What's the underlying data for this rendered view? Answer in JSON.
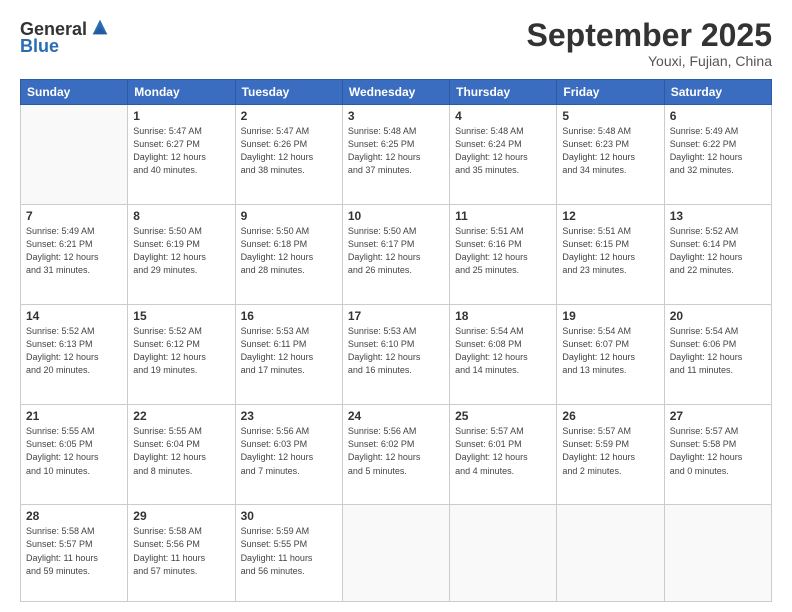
{
  "header": {
    "logo_general": "General",
    "logo_blue": "Blue",
    "month_title": "September 2025",
    "location": "Youxi, Fujian, China"
  },
  "weekdays": [
    "Sunday",
    "Monday",
    "Tuesday",
    "Wednesday",
    "Thursday",
    "Friday",
    "Saturday"
  ],
  "weeks": [
    [
      {
        "day": "",
        "info": ""
      },
      {
        "day": "1",
        "info": "Sunrise: 5:47 AM\nSunset: 6:27 PM\nDaylight: 12 hours\nand 40 minutes."
      },
      {
        "day": "2",
        "info": "Sunrise: 5:47 AM\nSunset: 6:26 PM\nDaylight: 12 hours\nand 38 minutes."
      },
      {
        "day": "3",
        "info": "Sunrise: 5:48 AM\nSunset: 6:25 PM\nDaylight: 12 hours\nand 37 minutes."
      },
      {
        "day": "4",
        "info": "Sunrise: 5:48 AM\nSunset: 6:24 PM\nDaylight: 12 hours\nand 35 minutes."
      },
      {
        "day": "5",
        "info": "Sunrise: 5:48 AM\nSunset: 6:23 PM\nDaylight: 12 hours\nand 34 minutes."
      },
      {
        "day": "6",
        "info": "Sunrise: 5:49 AM\nSunset: 6:22 PM\nDaylight: 12 hours\nand 32 minutes."
      }
    ],
    [
      {
        "day": "7",
        "info": "Sunrise: 5:49 AM\nSunset: 6:21 PM\nDaylight: 12 hours\nand 31 minutes."
      },
      {
        "day": "8",
        "info": "Sunrise: 5:50 AM\nSunset: 6:19 PM\nDaylight: 12 hours\nand 29 minutes."
      },
      {
        "day": "9",
        "info": "Sunrise: 5:50 AM\nSunset: 6:18 PM\nDaylight: 12 hours\nand 28 minutes."
      },
      {
        "day": "10",
        "info": "Sunrise: 5:50 AM\nSunset: 6:17 PM\nDaylight: 12 hours\nand 26 minutes."
      },
      {
        "day": "11",
        "info": "Sunrise: 5:51 AM\nSunset: 6:16 PM\nDaylight: 12 hours\nand 25 minutes."
      },
      {
        "day": "12",
        "info": "Sunrise: 5:51 AM\nSunset: 6:15 PM\nDaylight: 12 hours\nand 23 minutes."
      },
      {
        "day": "13",
        "info": "Sunrise: 5:52 AM\nSunset: 6:14 PM\nDaylight: 12 hours\nand 22 minutes."
      }
    ],
    [
      {
        "day": "14",
        "info": "Sunrise: 5:52 AM\nSunset: 6:13 PM\nDaylight: 12 hours\nand 20 minutes."
      },
      {
        "day": "15",
        "info": "Sunrise: 5:52 AM\nSunset: 6:12 PM\nDaylight: 12 hours\nand 19 minutes."
      },
      {
        "day": "16",
        "info": "Sunrise: 5:53 AM\nSunset: 6:11 PM\nDaylight: 12 hours\nand 17 minutes."
      },
      {
        "day": "17",
        "info": "Sunrise: 5:53 AM\nSunset: 6:10 PM\nDaylight: 12 hours\nand 16 minutes."
      },
      {
        "day": "18",
        "info": "Sunrise: 5:54 AM\nSunset: 6:08 PM\nDaylight: 12 hours\nand 14 minutes."
      },
      {
        "day": "19",
        "info": "Sunrise: 5:54 AM\nSunset: 6:07 PM\nDaylight: 12 hours\nand 13 minutes."
      },
      {
        "day": "20",
        "info": "Sunrise: 5:54 AM\nSunset: 6:06 PM\nDaylight: 12 hours\nand 11 minutes."
      }
    ],
    [
      {
        "day": "21",
        "info": "Sunrise: 5:55 AM\nSunset: 6:05 PM\nDaylight: 12 hours\nand 10 minutes."
      },
      {
        "day": "22",
        "info": "Sunrise: 5:55 AM\nSunset: 6:04 PM\nDaylight: 12 hours\nand 8 minutes."
      },
      {
        "day": "23",
        "info": "Sunrise: 5:56 AM\nSunset: 6:03 PM\nDaylight: 12 hours\nand 7 minutes."
      },
      {
        "day": "24",
        "info": "Sunrise: 5:56 AM\nSunset: 6:02 PM\nDaylight: 12 hours\nand 5 minutes."
      },
      {
        "day": "25",
        "info": "Sunrise: 5:57 AM\nSunset: 6:01 PM\nDaylight: 12 hours\nand 4 minutes."
      },
      {
        "day": "26",
        "info": "Sunrise: 5:57 AM\nSunset: 5:59 PM\nDaylight: 12 hours\nand 2 minutes."
      },
      {
        "day": "27",
        "info": "Sunrise: 5:57 AM\nSunset: 5:58 PM\nDaylight: 12 hours\nand 0 minutes."
      }
    ],
    [
      {
        "day": "28",
        "info": "Sunrise: 5:58 AM\nSunset: 5:57 PM\nDaylight: 11 hours\nand 59 minutes."
      },
      {
        "day": "29",
        "info": "Sunrise: 5:58 AM\nSunset: 5:56 PM\nDaylight: 11 hours\nand 57 minutes."
      },
      {
        "day": "30",
        "info": "Sunrise: 5:59 AM\nSunset: 5:55 PM\nDaylight: 11 hours\nand 56 minutes."
      },
      {
        "day": "",
        "info": ""
      },
      {
        "day": "",
        "info": ""
      },
      {
        "day": "",
        "info": ""
      },
      {
        "day": "",
        "info": ""
      }
    ]
  ]
}
